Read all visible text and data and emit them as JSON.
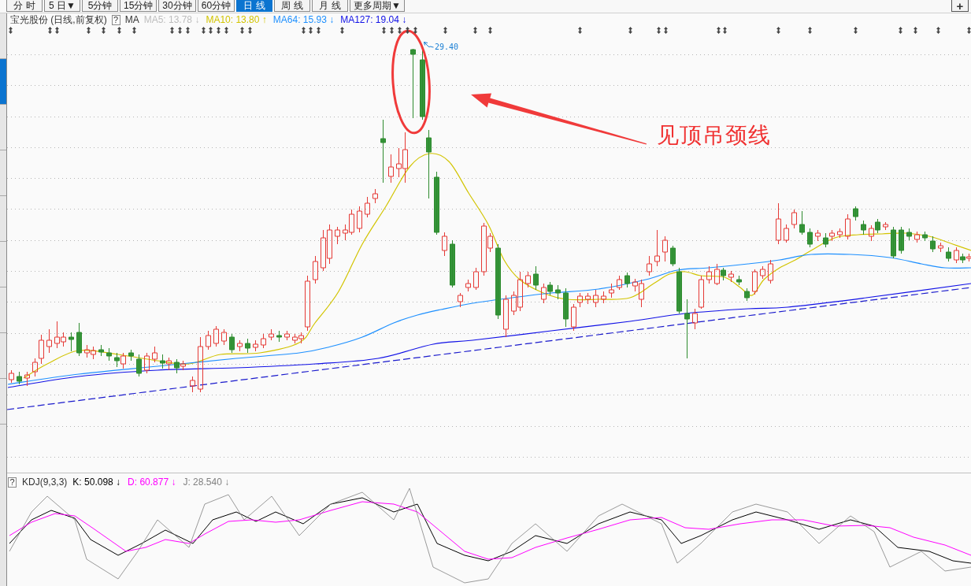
{
  "toolbar": {
    "periods": [
      {
        "label": "分 时",
        "selected": false
      },
      {
        "label": "5 日▼",
        "selected": false
      },
      {
        "label": "5分钟",
        "selected": false
      },
      {
        "label": "15分钟",
        "selected": false
      },
      {
        "label": "30分钟",
        "selected": false
      },
      {
        "label": "60分钟",
        "selected": false
      },
      {
        "label": "日 线",
        "selected": true
      },
      {
        "label": "周 线",
        "selected": false
      },
      {
        "label": "月 线",
        "selected": false
      },
      {
        "label": "更多周期▼",
        "selected": false
      }
    ],
    "add_button": "+"
  },
  "sidebar": {
    "tabs": [
      {
        "selected": false
      },
      {
        "selected": true
      },
      {
        "selected": false
      },
      {
        "selected": false
      },
      {
        "selected": false
      },
      {
        "selected": false
      },
      {
        "selected": false
      },
      {
        "selected": false
      },
      {
        "selected": false
      }
    ]
  },
  "chart": {
    "title": "宝光股份 (日线,前复权)",
    "help": "?",
    "indicator": "MA",
    "ma_values": [
      {
        "text": "MA5: 13.78 ↓",
        "color": "#bdbdbd"
      },
      {
        "text": "MA10: 13.80 ↑",
        "color": "#d2c400"
      },
      {
        "text": "MA64: 15.93 ↓",
        "color": "#1e90ff"
      },
      {
        "text": "MA127: 19.04 ↓",
        "color": "#1010e6"
      }
    ],
    "peak_label": "29.40",
    "annotation": "见顶吊颈线"
  },
  "kdj": {
    "help": "?",
    "title": "KDJ(9,3,3)",
    "values": [
      {
        "text": "K: 50.098 ↓",
        "color": "#000000"
      },
      {
        "text": "D: 60.877 ↓",
        "color": "#ff00ff"
      },
      {
        "text": "J: 28.540 ↓",
        "color": "#808080"
      }
    ]
  }
}
